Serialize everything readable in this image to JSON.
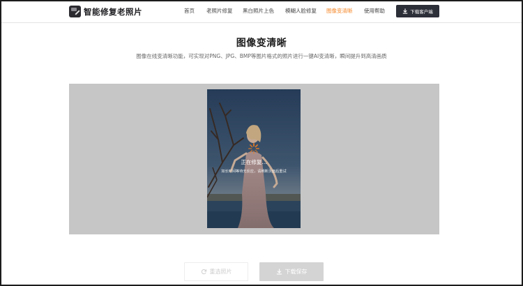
{
  "app": {
    "name": "智能修复老照片"
  },
  "nav": {
    "items": [
      {
        "label": "首页",
        "active": false
      },
      {
        "label": "老照片修复",
        "active": false
      },
      {
        "label": "黑白照片上色",
        "active": false
      },
      {
        "label": "模糊人脸修复",
        "active": false
      },
      {
        "label": "图像变清晰",
        "active": true
      },
      {
        "label": "使用帮助",
        "active": false
      }
    ],
    "download_client_label": "下载客户端"
  },
  "page": {
    "title": "图像变清晰",
    "subtitle": "图像在线变清晰功能，可实现对PNG、JPG、BMP等图片格式的照片进行一键AI变清晰，瞬间提升到高清画质"
  },
  "processing": {
    "status_title": "正在修复...",
    "status_hint": "如长时间等待无反应，请刷新页面后重试"
  },
  "actions": {
    "reselect_label": "重选照片",
    "save_label": "下载保存"
  },
  "colors": {
    "accent": "#f5882a",
    "header_button": "#2c2e38",
    "workspace_bg": "#c6c6c6",
    "save_button_disabled": "#d4d4d4"
  },
  "icons": {
    "logo": "photo-restore-logo-icon",
    "download": "download-icon",
    "spinner": "loading-spinner-icon",
    "refresh": "refresh-icon"
  }
}
